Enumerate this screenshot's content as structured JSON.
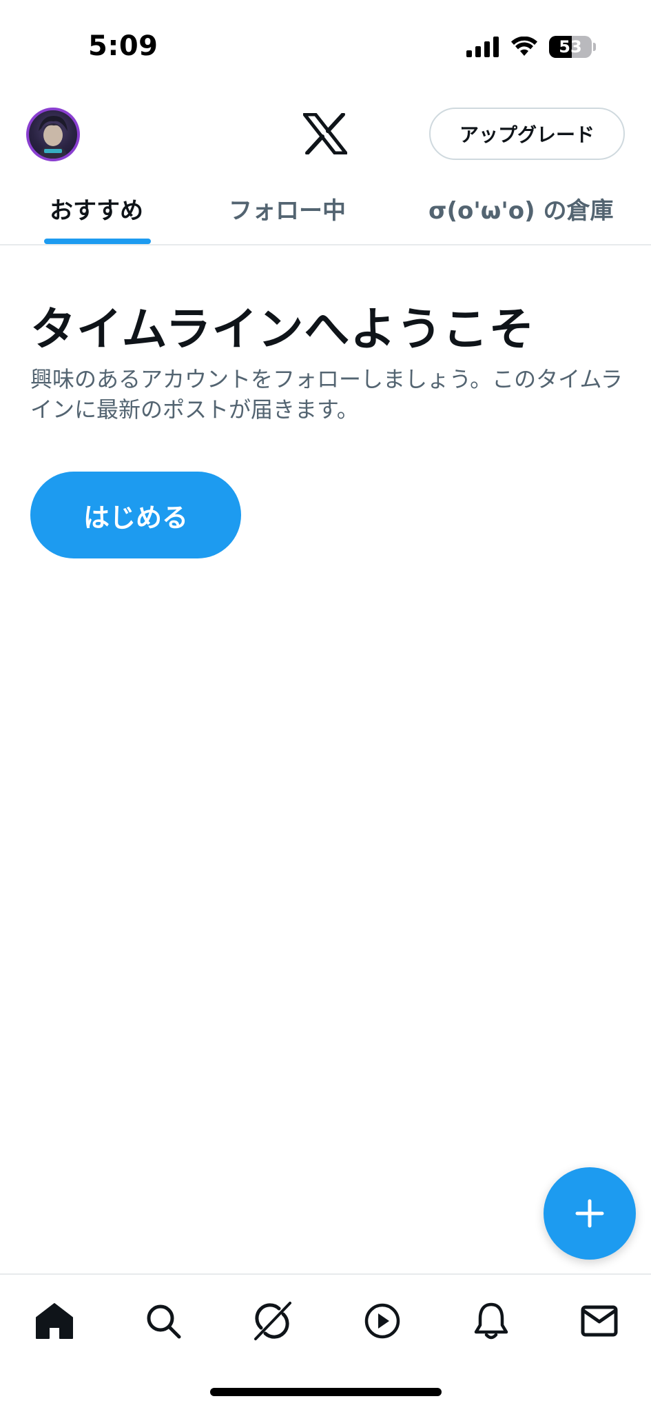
{
  "status_bar": {
    "time": "5:09",
    "battery_level": "53",
    "battery_fraction": 0.53,
    "icons": [
      "cellular-signal-icon",
      "wifi-icon",
      "battery-icon"
    ]
  },
  "header": {
    "avatar": "profile-avatar",
    "logo": "x-logo-icon",
    "upgrade_label": "アップグレード"
  },
  "tabs": [
    {
      "label": "おすすめ",
      "active": true
    },
    {
      "label": "フォロー中",
      "active": false
    },
    {
      "label": "σ(o'ω'o) の倉庫",
      "active": false
    }
  ],
  "main": {
    "title": "タイムラインへようこそ",
    "description": "興味のあるアカウントをフォローしましょう。このタイムラインに最新のポストが届きます。",
    "start_button_label": "はじめる"
  },
  "fab": {
    "icon": "plus-icon"
  },
  "bottom_nav": {
    "items": [
      {
        "icon": "home-icon",
        "active": true
      },
      {
        "icon": "search-icon",
        "active": false
      },
      {
        "icon": "grok-icon",
        "active": false
      },
      {
        "icon": "video-play-icon",
        "active": false
      },
      {
        "icon": "bell-icon",
        "active": false
      },
      {
        "icon": "mail-icon",
        "active": false
      }
    ]
  },
  "colors": {
    "accent": "#1d9bf0",
    "text_primary": "#0f1419",
    "text_secondary": "#536471",
    "border": "#e7eaec"
  }
}
